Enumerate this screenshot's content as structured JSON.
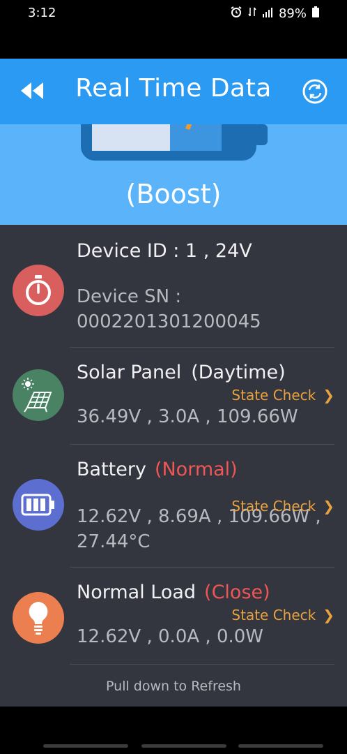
{
  "status_bar": {
    "time": "3:12",
    "battery": "89%"
  },
  "app_bar": {
    "title": "Real Time Data"
  },
  "hero": {
    "mode": "(Boost)"
  },
  "device": {
    "id_label": "Device ID : 1 , 24V",
    "sn_label": "Device SN :",
    "sn_value": "0002201301200045"
  },
  "solar": {
    "label": "Solar Panel",
    "status": "(Daytime)",
    "state_check": "State Check",
    "values": "36.49V , 3.0A , 109.66W"
  },
  "battery": {
    "label": "Battery",
    "status": "(Normal)",
    "state_check": "State Check",
    "values_line1": "12.62V , 8.69A , 109.66W ,",
    "values_line2": "27.44°C"
  },
  "load": {
    "label": "Normal Load",
    "status": "(Close)",
    "state_check": "State Check",
    "values": "12.62V , 0.0A , 0.0W"
  },
  "footer": {
    "pull_refresh": "Pull down to Refresh"
  },
  "colors": {
    "app_bar": "#2b9af3",
    "hero": "#5bb4f9",
    "panel": "#33353f",
    "accent_orange": "#e8a23e",
    "status_red": "#ef5656"
  },
  "icons": [
    "alarm-icon",
    "data-icon",
    "signal-icon",
    "battery-icon",
    "rewind-icon",
    "refresh-icon",
    "stopwatch-icon",
    "solar-panel-icon",
    "battery-level-icon",
    "bulb-icon"
  ]
}
